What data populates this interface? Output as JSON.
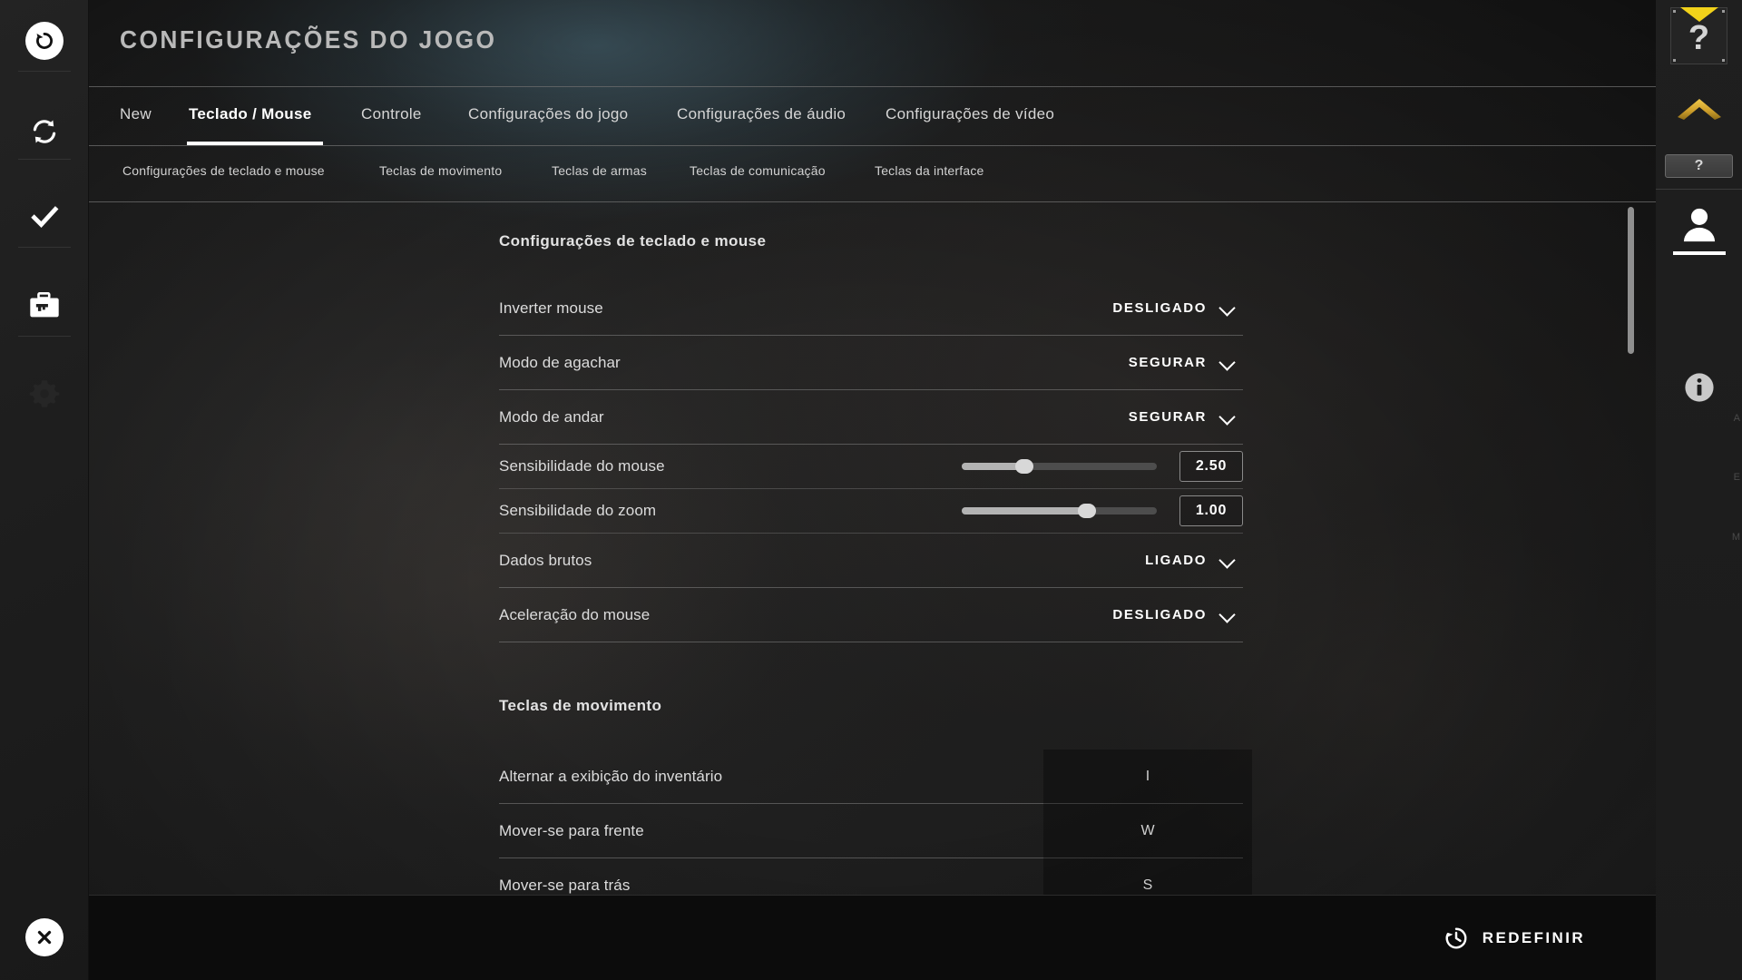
{
  "header": {
    "title": "CONFIGURAÇÕES DO JOGO"
  },
  "tabs": [
    {
      "label": "New",
      "active": false
    },
    {
      "label": "Teclado / Mouse",
      "active": true
    },
    {
      "label": "Controle",
      "active": false
    },
    {
      "label": "Configurações do jogo",
      "active": false
    },
    {
      "label": "Configurações de áudio",
      "active": false
    },
    {
      "label": "Configurações de vídeo",
      "active": false
    }
  ],
  "subtabs": [
    {
      "label": "Configurações de teclado e mouse"
    },
    {
      "label": "Teclas de movimento"
    },
    {
      "label": "Teclas de armas"
    },
    {
      "label": "Teclas de comunicação"
    },
    {
      "label": "Teclas da interface"
    }
  ],
  "sections": [
    {
      "heading": "Configurações de teclado e mouse",
      "rows": [
        {
          "type": "dropdown",
          "label": "Inverter mouse",
          "value": "DESLIGADO"
        },
        {
          "type": "dropdown",
          "label": "Modo de agachar",
          "value": "SEGURAR"
        },
        {
          "type": "dropdown",
          "label": "Modo de andar",
          "value": "SEGURAR"
        },
        {
          "type": "slider",
          "label": "Sensibilidade do mouse",
          "value": "2.50",
          "percent": 32
        },
        {
          "type": "slider",
          "label": "Sensibilidade do zoom",
          "value": "1.00",
          "percent": 64
        },
        {
          "type": "dropdown",
          "label": "Dados brutos",
          "value": "LIGADO"
        },
        {
          "type": "dropdown",
          "label": "Aceleração do mouse",
          "value": "DESLIGADO"
        }
      ]
    },
    {
      "heading": "Teclas de movimento",
      "rows": [
        {
          "type": "keybind",
          "label": "Alternar a exibição do inventário",
          "value": "I"
        },
        {
          "type": "keybind",
          "label": "Mover-se para frente",
          "value": "W"
        },
        {
          "type": "keybind",
          "label": "Mover-se para trás",
          "value": "S"
        }
      ]
    }
  ],
  "footer": {
    "reset_label": "REDEFINIR",
    "reset_icon": "history-icon"
  },
  "left_rail": [
    {
      "icon": "back-arrow-icon"
    },
    {
      "icon": "sync-refresh-icon"
    },
    {
      "icon": "checkmark-icon"
    },
    {
      "icon": "weapon-case-icon"
    },
    {
      "icon": "gear-icon"
    }
  ],
  "left_rail_bottom": {
    "icon": "close-circle-icon"
  },
  "right_rail": {
    "help_marker": "?",
    "help_button": "?",
    "icons": [
      "chevron-up-gold-icon",
      "person-icon",
      "info-icon"
    ]
  },
  "colors": {
    "accent_yellow": "#f2d21a",
    "accent_gold": "#c79a2e",
    "panel_bg": "#212121",
    "footer_bg": "#0c0c0c",
    "text_primary": "#ffffff",
    "text_secondary": "#d6d6d6",
    "glow_blue": "#4a6b7a"
  }
}
